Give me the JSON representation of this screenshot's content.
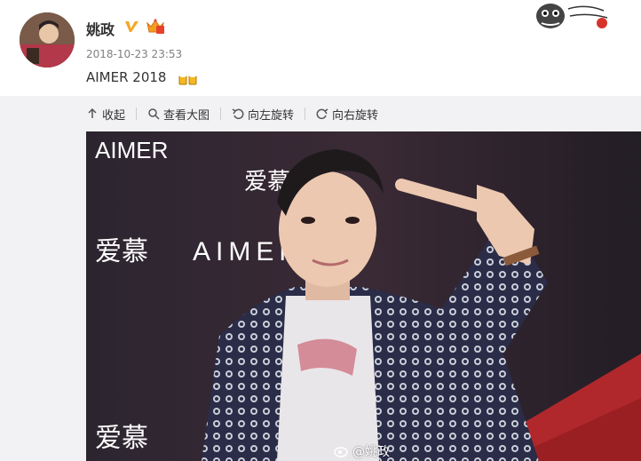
{
  "post": {
    "author": "姚政",
    "timestamp": "2018-10-23 23:53",
    "text": "AIMER 2018"
  },
  "toolbar": {
    "collapse_label": "收起",
    "view_large_label": "查看大图",
    "rotate_left_label": "向左旋转",
    "rotate_right_label": "向右旋转"
  },
  "photo": {
    "watermark": "@姚政",
    "backdrop_text": [
      "AIMER",
      "爱慕"
    ]
  },
  "colors": {
    "verified_badge": "#f5a623",
    "carpet_red": "#b0282b",
    "backdrop": "#2a2530"
  },
  "icons": [
    "verified-icon",
    "crown-icon",
    "beer-emoji",
    "collapse-icon",
    "search-icon",
    "rotate-left-icon",
    "rotate-right-icon",
    "weibo-icon",
    "mascot-icon"
  ]
}
